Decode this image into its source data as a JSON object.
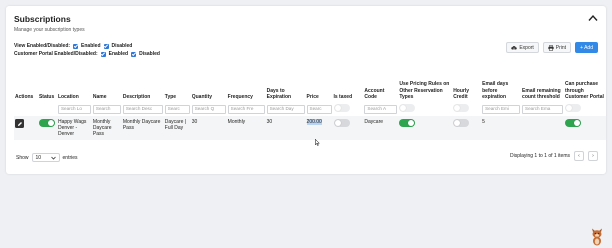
{
  "header": {
    "title": "Subscriptions",
    "subtitle": "Manage your subscription types"
  },
  "filters": {
    "row1_label": "View Enabled/Disabled:",
    "row1_opt1": "Enabled",
    "row1_opt2": "Disabled",
    "row2_label": "Customer Portal Enabled/Disabled:",
    "row2_opt1": "Enabled",
    "row2_opt2": "Disabled"
  },
  "toolbar": {
    "export_label": "Export",
    "print_label": "Print",
    "add_label": "+ Add"
  },
  "table": {
    "headers": {
      "actions": "Actions",
      "status": "Status",
      "location": "Location",
      "name": "Name",
      "description": "Description",
      "type": "Type",
      "quantity": "Quantity",
      "frequency": "Frequency",
      "days": "Days to Expiration",
      "price": "Price",
      "taxed": "Is taxed",
      "account": "Account Code",
      "pricing_rules": "Use Pricing Rules on Other Reservation Types",
      "hourly": "Hourly Credit",
      "email_days": "Email days before expiration",
      "email_remaining": "Email remaining count threshold",
      "portal": "Can purchase through Customer Portal"
    },
    "search": {
      "location": "Search Lo",
      "name": "Search",
      "description": "Search Desc",
      "type": "Searc",
      "quantity": "Search Q",
      "frequency": "Search Fre",
      "days": "Search Day",
      "price": "Searc",
      "account": "Search A",
      "email_days": "Search Emi",
      "email_remaining": "Search Ema"
    },
    "row": {
      "location": "Happy Wags Denver - Denver",
      "name": "Monthly Daycare Pass",
      "description": "Monthly Daycare Pass",
      "type": "Daycare | Full Day",
      "quantity": "30",
      "frequency": "Monthly",
      "days": "30",
      "price": "200.00",
      "account": "Daycare",
      "email_days": "5",
      "email_remaining": "",
      "status_on": true,
      "taxed_on": false,
      "pricing_rules_on": true,
      "hourly_on": false,
      "portal_on": true
    }
  },
  "footer": {
    "show_label": "Show",
    "page_size": "10",
    "entries_label": "entries",
    "info": "Displaying 1 to 1 of 1 items",
    "prev": "‹",
    "next": "›"
  },
  "colors": {
    "accent": "#3289e6",
    "toggle_on": "#2fa44f",
    "toggle_off": "#d6d8db"
  }
}
